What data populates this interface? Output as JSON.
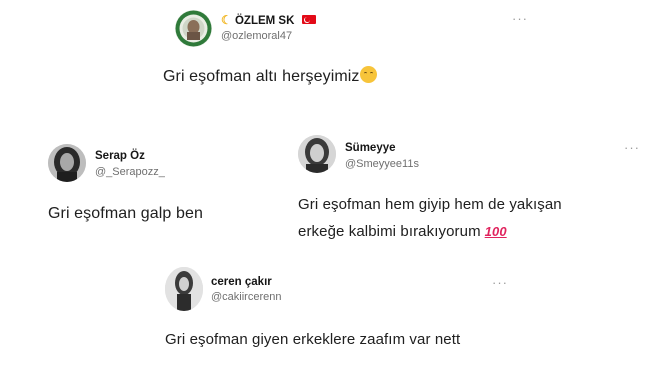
{
  "tweets": [
    {
      "name": "ÖZLEM SK",
      "name_prefix_icon": "crescent-moon-emoji",
      "name_suffix_icon": "turkey-flag-emoji",
      "handle": "@ozlemoral47",
      "text": "Gri eşofman altı herşeyimiz",
      "text_emoji": "relieved-face-emoji",
      "more": "···"
    },
    {
      "name": "Serap Öz",
      "handle": "@_Serapozz_",
      "text": "Gri eşofman galp ben"
    },
    {
      "name": "Sümeyye",
      "handle": "@Smeyyee11s",
      "text_line1": "Gri eşofman hem giyip hem de yakışan",
      "text_line2": "erkeğe kalbimi bırakıyorum",
      "text_emoji": "hundred-points-emoji",
      "more": "···"
    },
    {
      "name": "ceren çakır",
      "handle": "@cakiircerenn",
      "text": "Gri eşofman giyen erkeklere zaafım var nett",
      "more": "···"
    }
  ],
  "colors": {
    "name": "#161616",
    "handle": "#6f6f6f",
    "body_text": "#202020",
    "flag_red": "#e30a17",
    "hundred_red": "#e0245e"
  }
}
